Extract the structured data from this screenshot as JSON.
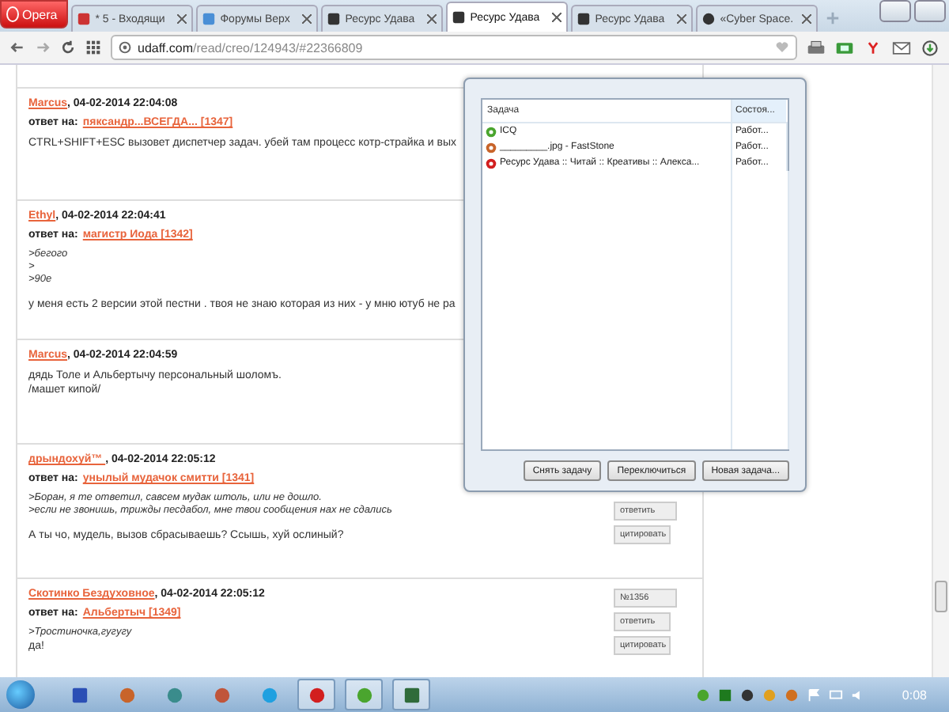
{
  "browser": {
    "menu_label": "Opera",
    "tabs": [
      {
        "title": "* 5 - Входящи",
        "selected": false
      },
      {
        "title": "Форумы Верх",
        "selected": false
      },
      {
        "title": "Ресурс Удава",
        "selected": false
      },
      {
        "title": "Ресурс Удава",
        "selected": true
      },
      {
        "title": "Ресурс Удава",
        "selected": false
      },
      {
        "title": "«Cyber Space.",
        "selected": false
      }
    ],
    "address": {
      "domain": "udaff.com",
      "path": "/read/creo/124943/#22366809"
    }
  },
  "posts": [
    {
      "author": "Marcus",
      "date": ", 04-02-2014 22:04:08",
      "reply_label": "ответ на:",
      "reply_to": "пяксандр...ВСЕГДА... [1347]",
      "lines": [
        {
          "kind": "text",
          "text": "CTRL+SHIFT+ESC вызовет диспетчер задач. убей там процесс котр-страйка и вых"
        }
      ]
    },
    {
      "author": "Ethyl",
      "date": ", 04-02-2014 22:04:41",
      "reply_label": "ответ на:",
      "reply_to": "магистр Иода [1342]",
      "lines": [
        {
          "kind": "quote",
          "text": ">бегого"
        },
        {
          "kind": "quote",
          "text": ">"
        },
        {
          "kind": "quote",
          "text": ">90е"
        },
        {
          "kind": "para",
          "text": "у меня есть 2 версии этой пестни . твоя не знаю  которая из них - у мню ютуб не ра"
        }
      ]
    },
    {
      "author": "Marcus",
      "date": ", 04-02-2014 22:04:59",
      "lines": [
        {
          "kind": "text",
          "text": "дядь Толе и Альбертычу персональный шоломъ."
        },
        {
          "kind": "text",
          "text": "/машет кипой/"
        }
      ]
    },
    {
      "author": "дрындохуй™ ",
      "date": ", 04-02-2014 22:05:12",
      "reply_label": "ответ на:",
      "reply_to": "унылый мудачок смитти [1341]",
      "lines": [
        {
          "kind": "quote",
          "text": ">Боран, я те ответил, савсем мудак штоль, или не дошло."
        },
        {
          "kind": "quote",
          "text": ">если не звонишь, трижды песдабол, мне твои сообщения нах не сдались"
        },
        {
          "kind": "para",
          "text": "А ты чо, мудель, вызов сбрасываешь? Ссышь, хуй ослиный?"
        }
      ],
      "buttons": [
        "ответить",
        "цитировать"
      ]
    },
    {
      "author": "Скотинко  Бездуховное",
      "date": ", 04-02-2014 22:05:12",
      "reply_label": "ответ на:",
      "reply_to": "Альбертыч [1349]",
      "lines": [
        {
          "kind": "quote",
          "text": ">Тростиночка,гугугу"
        },
        {
          "kind": "text",
          "text": "да!"
        }
      ],
      "buttons": [
        "№1356",
        "ответить",
        "цитировать"
      ]
    }
  ],
  "task_manager": {
    "columns": [
      "Задача",
      "Состоя..."
    ],
    "rows": [
      {
        "name": "ICQ",
        "status": "Работ..."
      },
      {
        "name": "_________.jpg - FastStone",
        "status": "Работ..."
      },
      {
        "name": "Ресурс Удава :: Читай :: Креативы :: Алекса...",
        "status": "Работ..."
      }
    ],
    "buttons": [
      "Снять задачу",
      "Переключиться",
      "Новая задача..."
    ]
  },
  "taskbar": {
    "apps": [
      {
        "active": false
      },
      {
        "active": false
      },
      {
        "active": false
      },
      {
        "active": false
      },
      {
        "active": false
      },
      {
        "active": true
      },
      {
        "active": true
      },
      {
        "active": true
      }
    ],
    "clock": "0:08"
  }
}
